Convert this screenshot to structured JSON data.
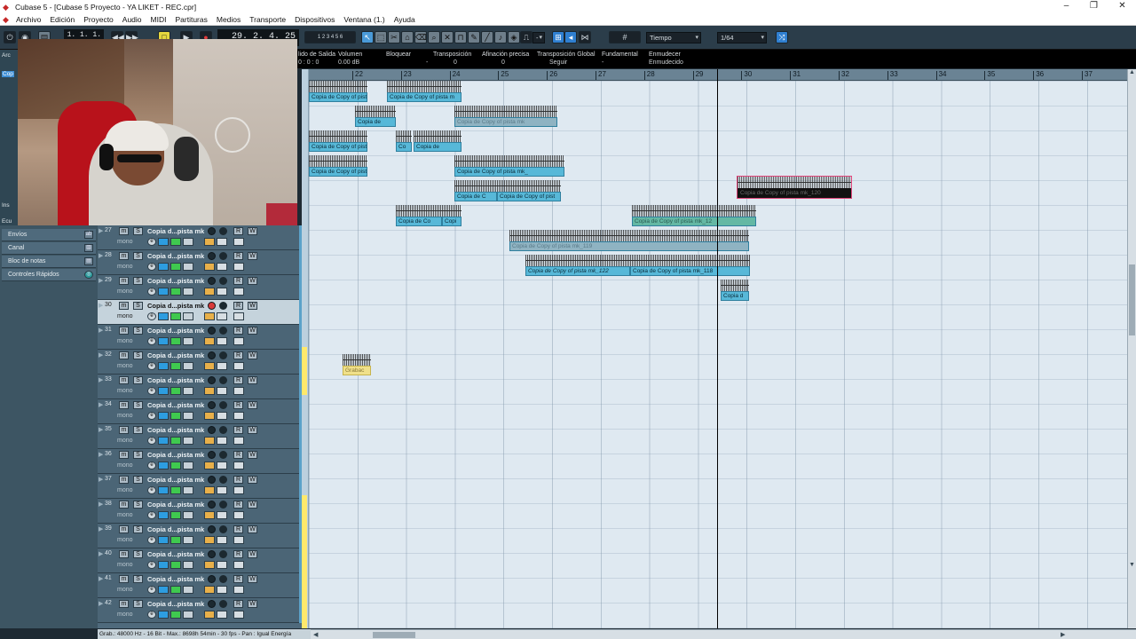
{
  "window": {
    "title": "Cubase 5 - [Cubase 5 Proyecto - YA LIKET - REC.cpr]",
    "controls": [
      "–",
      "❐",
      "✕"
    ]
  },
  "menu": [
    "Archivo",
    "Edición",
    "Proyecto",
    "Audio",
    "MIDI",
    "Partituras",
    "Medios",
    "Transporte",
    "Dispositivos",
    "Ventana (1.)",
    "Ayuda"
  ],
  "toolbar": {
    "position_small": "1. 1. 1.   0",
    "position_big": "29. 2. 4. 25",
    "grid_label": "Tiempo",
    "quantize": "1/64",
    "snap_value": "-"
  },
  "infoline": {
    "labels": [
      "lido de Salida",
      "Volumen",
      "Bloquear",
      "Transposición",
      "Afinación precisa",
      "Transposición Global",
      "Fundamental",
      "Enmudecer"
    ],
    "values": [
      "0 : 0 : 0",
      "0.00 dB",
      "-",
      "0",
      "0",
      "Seguir",
      "-",
      "Enmudecido"
    ]
  },
  "ruler": [
    "22",
    "23",
    "24",
    "25",
    "26",
    "27",
    "28",
    "29",
    "30",
    "31",
    "32",
    "33",
    "34",
    "35",
    "36",
    "37"
  ],
  "inspector": {
    "left_tabs": [
      "Arc",
      "Cop",
      "Ins",
      "Ecu"
    ],
    "sections": [
      "Envíos",
      "Canal",
      "Bloc de notas",
      "Controles Rápidos"
    ]
  },
  "track_name": "Copia d...pista mk",
  "track_mode": "mono",
  "tracks": [
    {
      "num": "27",
      "active": false
    },
    {
      "num": "28",
      "active": false
    },
    {
      "num": "29",
      "active": false
    },
    {
      "num": "30",
      "active": true
    },
    {
      "num": "31",
      "active": false
    },
    {
      "num": "32",
      "active": false
    },
    {
      "num": "33",
      "active": false
    },
    {
      "num": "34",
      "active": false
    },
    {
      "num": "35",
      "active": false
    },
    {
      "num": "36",
      "active": false
    },
    {
      "num": "37",
      "active": false
    },
    {
      "num": "38",
      "active": false
    },
    {
      "num": "39",
      "active": false
    },
    {
      "num": "40",
      "active": false
    },
    {
      "num": "41",
      "active": false
    },
    {
      "num": "42",
      "active": false
    }
  ],
  "clips": {
    "c1": "Copia de Copy of pista m",
    "c2": "Copia de Copy of pista m",
    "c3": "Copia de",
    "c4": "Copia de Copy of pista mk",
    "c5": "Copia de Copy of pista m",
    "c6": "Co",
    "c7": "Copia de",
    "c8": "Copia de Copy of pista",
    "c9": "Copia de Copy of pista mk_",
    "c10": "Copia de C",
    "c11": "Copia de Copy of pist",
    "c12": "Copia de Co",
    "c13": "Copi",
    "c14": "Copia de Copy of pista mk_120",
    "c15": "Copia de Copy of pista mk_12",
    "c16": "Copia de Copy of pista mk_119",
    "c17": "Copia de Copy of pista mk_122",
    "c18": "Copia de Copy of pista mk_118",
    "c19": "Copia d",
    "c20": "Grabac"
  },
  "statusbar": "Grab.: 48000 Hz - 16 Bit - Max.: 8698h 54min - 30 fps - Pan : Igual Energía"
}
